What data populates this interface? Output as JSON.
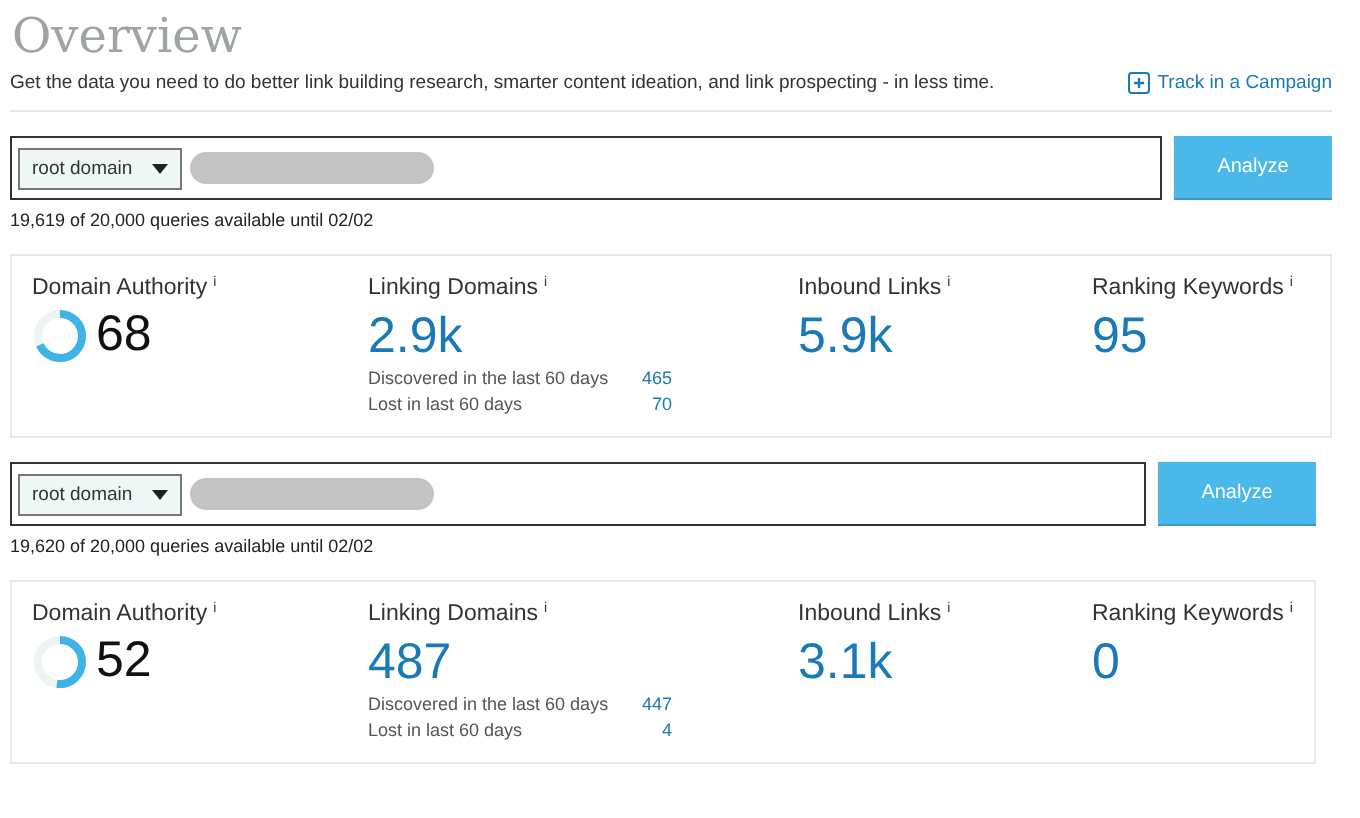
{
  "title": "Overview",
  "description": "Get the data you need to do better link building research, smarter content ideation, and link prospecting - in less time.",
  "campaign_link": "Track in a Campaign",
  "sections": [
    {
      "scope": "root domain",
      "button": "Analyze",
      "quota": "19,619 of 20,000 queries available until 02/02",
      "authority": {
        "label": "Domain Authority",
        "info": "i",
        "value": "68"
      },
      "linking": {
        "label": "Linking Domains",
        "info": "i",
        "value": "2.9k",
        "discovered_label": "Discovered in the last 60 days",
        "discovered": "465",
        "lost_label": "Lost in last 60 days",
        "lost": "70"
      },
      "inbound": {
        "label": "Inbound Links",
        "info": "i",
        "value": "5.9k"
      },
      "keywords": {
        "label": "Ranking Keywords",
        "info": "i",
        "value": "95"
      }
    },
    {
      "scope": "root domain",
      "button": "Analyze",
      "quota": "19,620 of 20,000 queries available until 02/02",
      "authority": {
        "label": "Domain Authority",
        "info": "i",
        "value": "52"
      },
      "linking": {
        "label": "Linking Domains",
        "info": "i",
        "value": "487",
        "discovered_label": "Discovered in the last 60 days",
        "discovered": "447",
        "lost_label": "Lost in last 60 days",
        "lost": "4"
      },
      "inbound": {
        "label": "Inbound Links",
        "info": "i",
        "value": "3.1k"
      },
      "keywords": {
        "label": "Ranking Keywords",
        "info": "i",
        "value": "0"
      }
    }
  ]
}
